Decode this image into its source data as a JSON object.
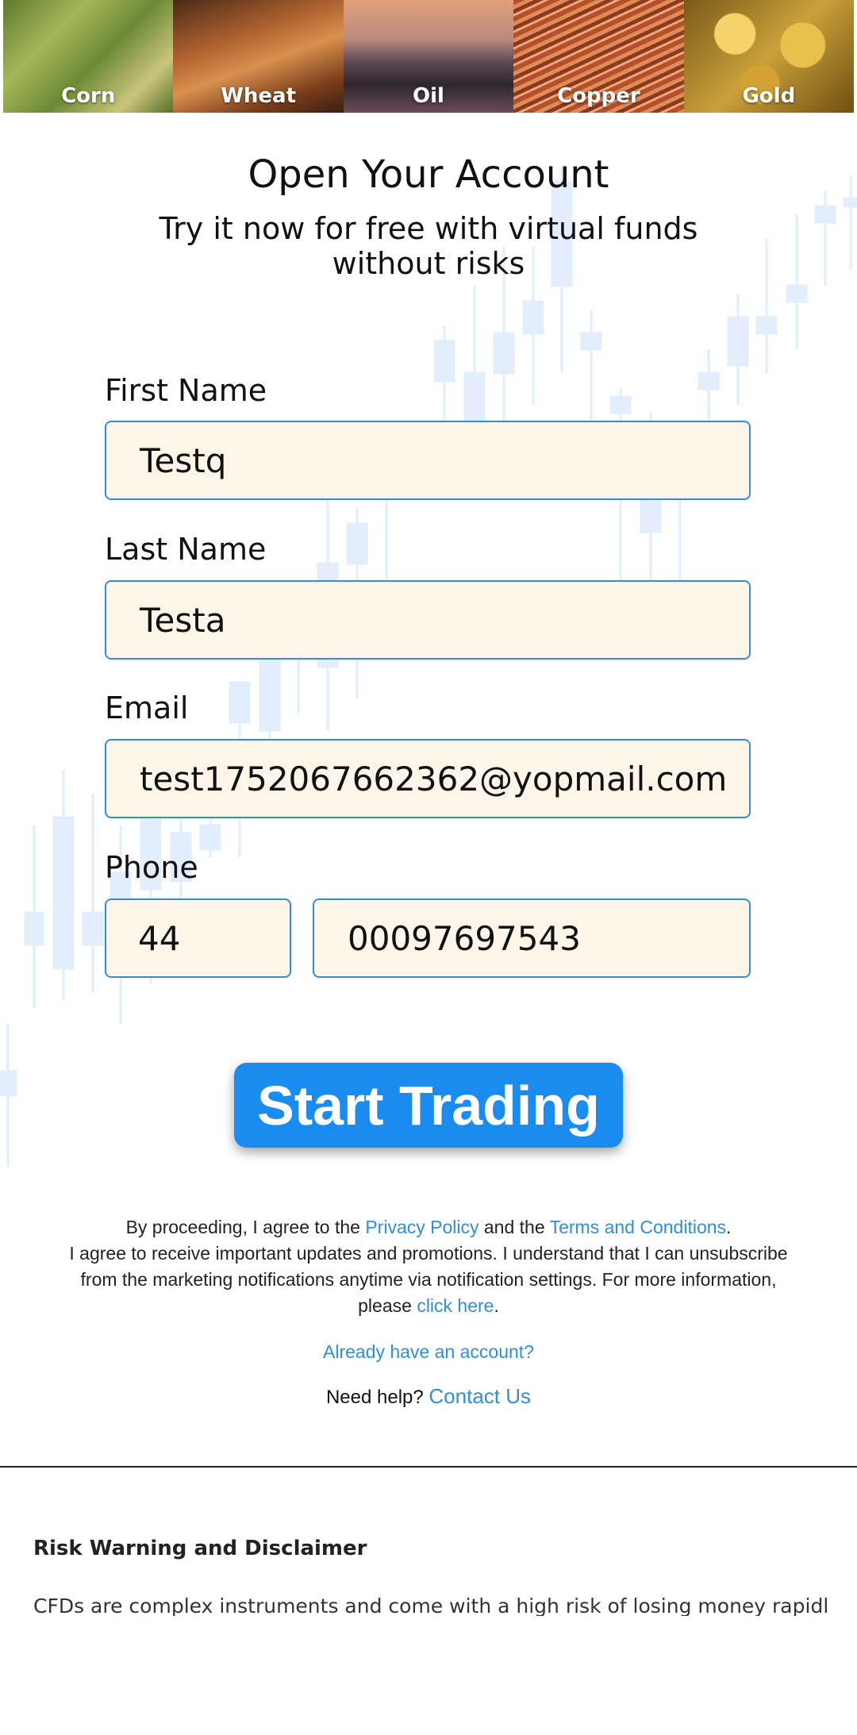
{
  "commodities": [
    "Corn",
    "Wheat",
    "Oil",
    "Copper",
    "Gold"
  ],
  "heading": {
    "title": "Open Your Account",
    "subtitle_line1": "Try it now for free with virtual funds",
    "subtitle_line2": "without risks"
  },
  "form": {
    "first_name_label": "First Name",
    "first_name_value": "Testq",
    "last_name_label": "Last Name",
    "last_name_value": "Testa",
    "email_label": "Email",
    "email_value": "test1752067662362@yopmail.com",
    "phone_label": "Phone",
    "phone_code_value": "44",
    "phone_number_value": "00097697543",
    "submit_label": "Start Trading"
  },
  "legal": {
    "proceed_prefix": "By proceeding, I agree to the ",
    "privacy_link": "Privacy Policy",
    "and_the": " and the ",
    "terms_link": "Terms and Conditions",
    "period": ".",
    "consent_text": "I agree to receive important updates and promotions. I understand that I can unsubscribe from the marketing notifications anytime via notification settings. For more information, please ",
    "click_here_link": "click here",
    "consent_end": "."
  },
  "already_account_link": "Already have an account?",
  "help": {
    "prefix": "Need help? ",
    "contact_link": "Contact Us"
  },
  "risk": {
    "title": "Risk Warning and Disclaimer",
    "text": "CFDs are complex instruments and come with a high risk of losing money rapidly due"
  },
  "colors": {
    "accent": "#1a8cf0",
    "link": "#2f8fdc",
    "field_bg": "#fdf6e8"
  }
}
